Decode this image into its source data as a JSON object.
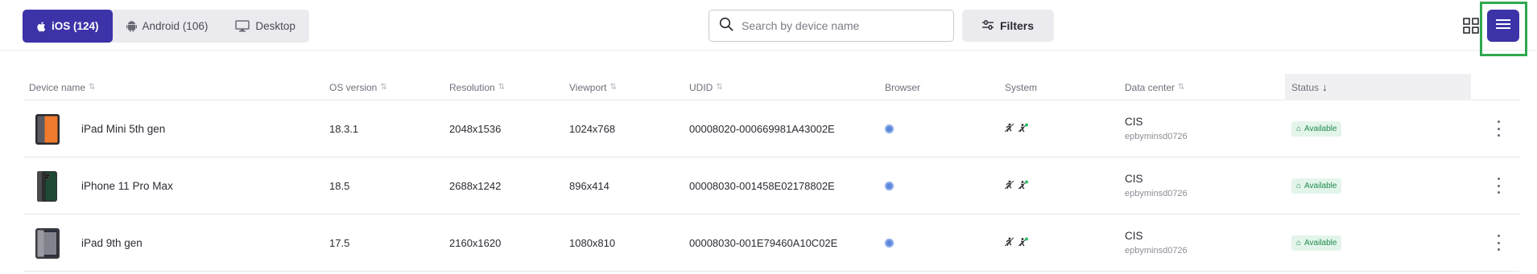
{
  "platform_tabs": [
    {
      "label": "iOS (124)",
      "icon": "apple-icon",
      "active": true
    },
    {
      "label": "Android (106)",
      "icon": "android-icon",
      "active": false
    },
    {
      "label": "Desktop",
      "icon": "desktop-icon",
      "active": false
    }
  ],
  "search": {
    "placeholder": "Search by device name",
    "value": ""
  },
  "filters_label": "Filters",
  "view_toggle": {
    "grid_icon": "grid-view-icon",
    "list_icon": "list-view-icon",
    "active": "list"
  },
  "colors": {
    "accent": "#3d33a8",
    "available": "#1f8a4c",
    "highlight": "#2fa84f"
  },
  "table": {
    "columns": [
      {
        "label": "Device name",
        "sortable": true,
        "sorted": false
      },
      {
        "label": "OS version",
        "sortable": true,
        "sorted": false
      },
      {
        "label": "Resolution",
        "sortable": true,
        "sorted": false
      },
      {
        "label": "Viewport",
        "sortable": true,
        "sorted": false
      },
      {
        "label": "UDID",
        "sortable": true,
        "sorted": false
      },
      {
        "label": "Browser",
        "sortable": false,
        "sorted": false
      },
      {
        "label": "System",
        "sortable": false,
        "sorted": false
      },
      {
        "label": "Data center",
        "sortable": true,
        "sorted": false
      },
      {
        "label": "Status",
        "sortable": true,
        "sorted": true,
        "direction": "desc"
      }
    ],
    "rows": [
      {
        "device": "iPad Mini 5th gen",
        "thumb": "tablet",
        "os": "18.3.1",
        "resolution": "2048x1536",
        "viewport": "1024x768",
        "udid": "00008020-000669981A43002E",
        "datacenter": "CIS",
        "host": "epbyminsd0726",
        "status": "Available"
      },
      {
        "device": "iPhone 11 Pro Max",
        "thumb": "phone",
        "os": "18.5",
        "resolution": "2688x1242",
        "viewport": "896x414",
        "udid": "00008030-001458E02178802E",
        "datacenter": "CIS",
        "host": "epbyminsd0726",
        "status": "Available"
      },
      {
        "device": "iPad 9th gen",
        "thumb": "tablet",
        "os": "17.5",
        "resolution": "2160x1620",
        "viewport": "1080x810",
        "udid": "00008030-001E79460A10C02E",
        "datacenter": "CIS",
        "host": "epbyminsd0726",
        "status": "Available"
      }
    ]
  }
}
